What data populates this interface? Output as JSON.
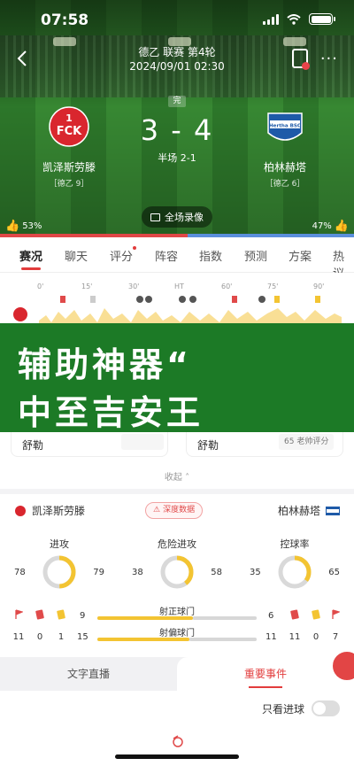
{
  "status_bar": {
    "time": "07:58"
  },
  "match": {
    "league_round": "德乙 联赛 第4轮",
    "datetime": "2024/09/01 02:30",
    "status": "完",
    "score": "3 - 4",
    "half_time": "半场 2-1",
    "home": {
      "name": "凯泽斯劳滕",
      "rank": "［德乙 9］",
      "crest_text": "FCK",
      "crest_num": "1",
      "vote": "53%",
      "vote_fraction": 0.53
    },
    "away": {
      "name": "柏林赫塔",
      "rank": "［德乙 6］",
      "crest_text": "Hertha BSC",
      "vote": "47%",
      "vote_fraction": 0.47
    },
    "replay_label": "全场录像"
  },
  "tabs": [
    "赛况",
    "聊天",
    "评分",
    "阵容",
    "指数",
    "预测",
    "方案",
    "热议"
  ],
  "active_tab": "赛况",
  "timeline": {
    "ticks": [
      "0'",
      "15'",
      "30'",
      "HT",
      "60'",
      "75'",
      "90'"
    ]
  },
  "banner": {
    "line1": "辅助神器“",
    "line2": "中至吉安王"
  },
  "coach": {
    "home_name": "舒勒",
    "away_name": "舒勒",
    "away_tag": "65 老帅评分"
  },
  "collapse_label": "收起",
  "stats": {
    "home_name": "凯泽斯劳滕",
    "away_name": "柏林赫塔",
    "deep_data_label": "深度数据",
    "rings": [
      {
        "title": "进攻",
        "home": "78",
        "away": "79"
      },
      {
        "title": "危险进攻",
        "home": "38",
        "away": "58"
      },
      {
        "title": "控球率",
        "home": "35",
        "away": "65"
      }
    ],
    "bars": [
      {
        "title": "射正球门",
        "home": "9",
        "away": "6",
        "home_fraction": 0.6
      },
      {
        "title": "射偏球门",
        "home": "15",
        "away": "11",
        "home_fraction": 0.58
      }
    ],
    "home_counts": {
      "corners": "11",
      "red": "0",
      "yellow": "1"
    },
    "away_counts": {
      "red": "11",
      "yellow": "0",
      "corners": "7"
    }
  },
  "sub_tabs": {
    "left": "文字直播",
    "right": "重要事件"
  },
  "goals_only_label": "只看进球",
  "colors": {
    "accent": "#e23c3c",
    "home_bar": "#f3c432",
    "banner": "#1c7a26"
  }
}
